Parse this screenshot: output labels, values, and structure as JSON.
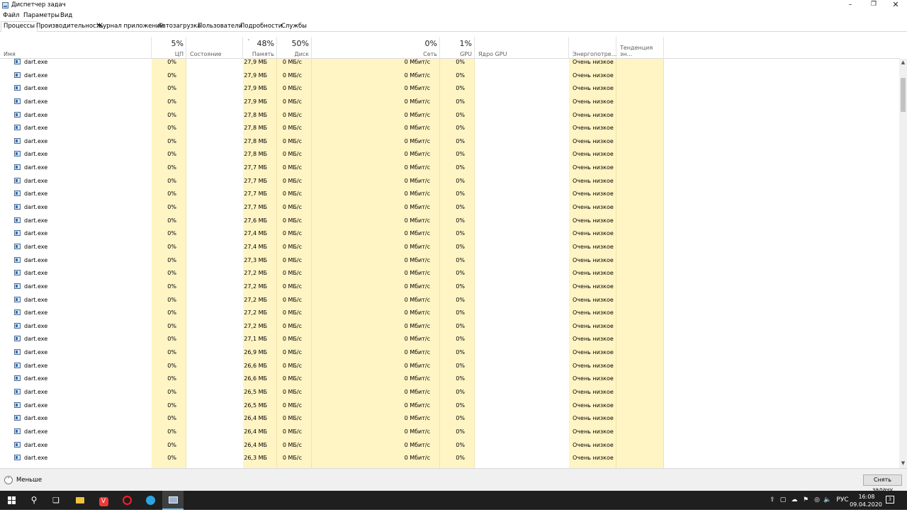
{
  "window": {
    "title": "Диспетчер задач"
  },
  "menu": [
    "Файл",
    "Параметры",
    "Вид"
  ],
  "tabs": [
    "Процессы",
    "Производительность",
    "Журнал приложений",
    "Автозагрузка",
    "Пользователи",
    "Подробности",
    "Службы"
  ],
  "active_tab": "Процессы",
  "columns": {
    "name": {
      "label": "Имя"
    },
    "cpu": {
      "pct": "5%",
      "label": "ЦП"
    },
    "status": {
      "label": "Состояние"
    },
    "memory": {
      "pct": "48%",
      "label": "Память"
    },
    "disk": {
      "pct": "50%",
      "label": "Диск"
    },
    "network": {
      "pct": "0%",
      "label": "Сеть"
    },
    "gpu": {
      "pct": "1%",
      "label": "GPU"
    },
    "gpu_engine": {
      "label": "Ядро GPU"
    },
    "power": {
      "label": "Энергопотре..."
    },
    "power_trend": {
      "label": "Тенденция эн..."
    }
  },
  "sort_indicator": "˅",
  "row_defaults": {
    "name": "dart.exe",
    "cpu": "0%",
    "disk": "0 МБ/с",
    "network": "0 Мбит/с",
    "gpu": "0%",
    "power": "Очень низкое"
  },
  "rows_memory": [
    "27,9 МБ",
    "27,9 МБ",
    "27,9 МБ",
    "27,9 МБ",
    "27,8 МБ",
    "27,8 МБ",
    "27,8 МБ",
    "27,8 МБ",
    "27,7 МБ",
    "27,7 МБ",
    "27,7 МБ",
    "27,7 МБ",
    "27,6 МБ",
    "27,4 МБ",
    "27,4 МБ",
    "27,3 МБ",
    "27,2 МБ",
    "27,2 МБ",
    "27,2 МБ",
    "27,2 МБ",
    "27,2 МБ",
    "27,1 МБ",
    "26,9 МБ",
    "26,6 МБ",
    "26,6 МБ",
    "26,5 МБ",
    "26,5 МБ",
    "26,4 МБ",
    "26,4 МБ",
    "26,4 МБ",
    "26,3 МБ"
  ],
  "footer": {
    "less_label": "Меньше",
    "end_task_label": "Снять задачу"
  },
  "taskbar": {
    "apps": [
      "start-icon",
      "search-icon",
      "task-view-icon",
      "file-explorer-icon",
      "vivaldi-icon",
      "opera-icon",
      "telegram-icon",
      "task-manager-icon"
    ],
    "language": "РУС",
    "time": "16:08",
    "date": "09.04.2020",
    "notification_count": "3"
  },
  "colors": {
    "highlight_column": "#fff4c4",
    "taskbar": "#1f1f1f",
    "accent": "#76b9ed"
  }
}
